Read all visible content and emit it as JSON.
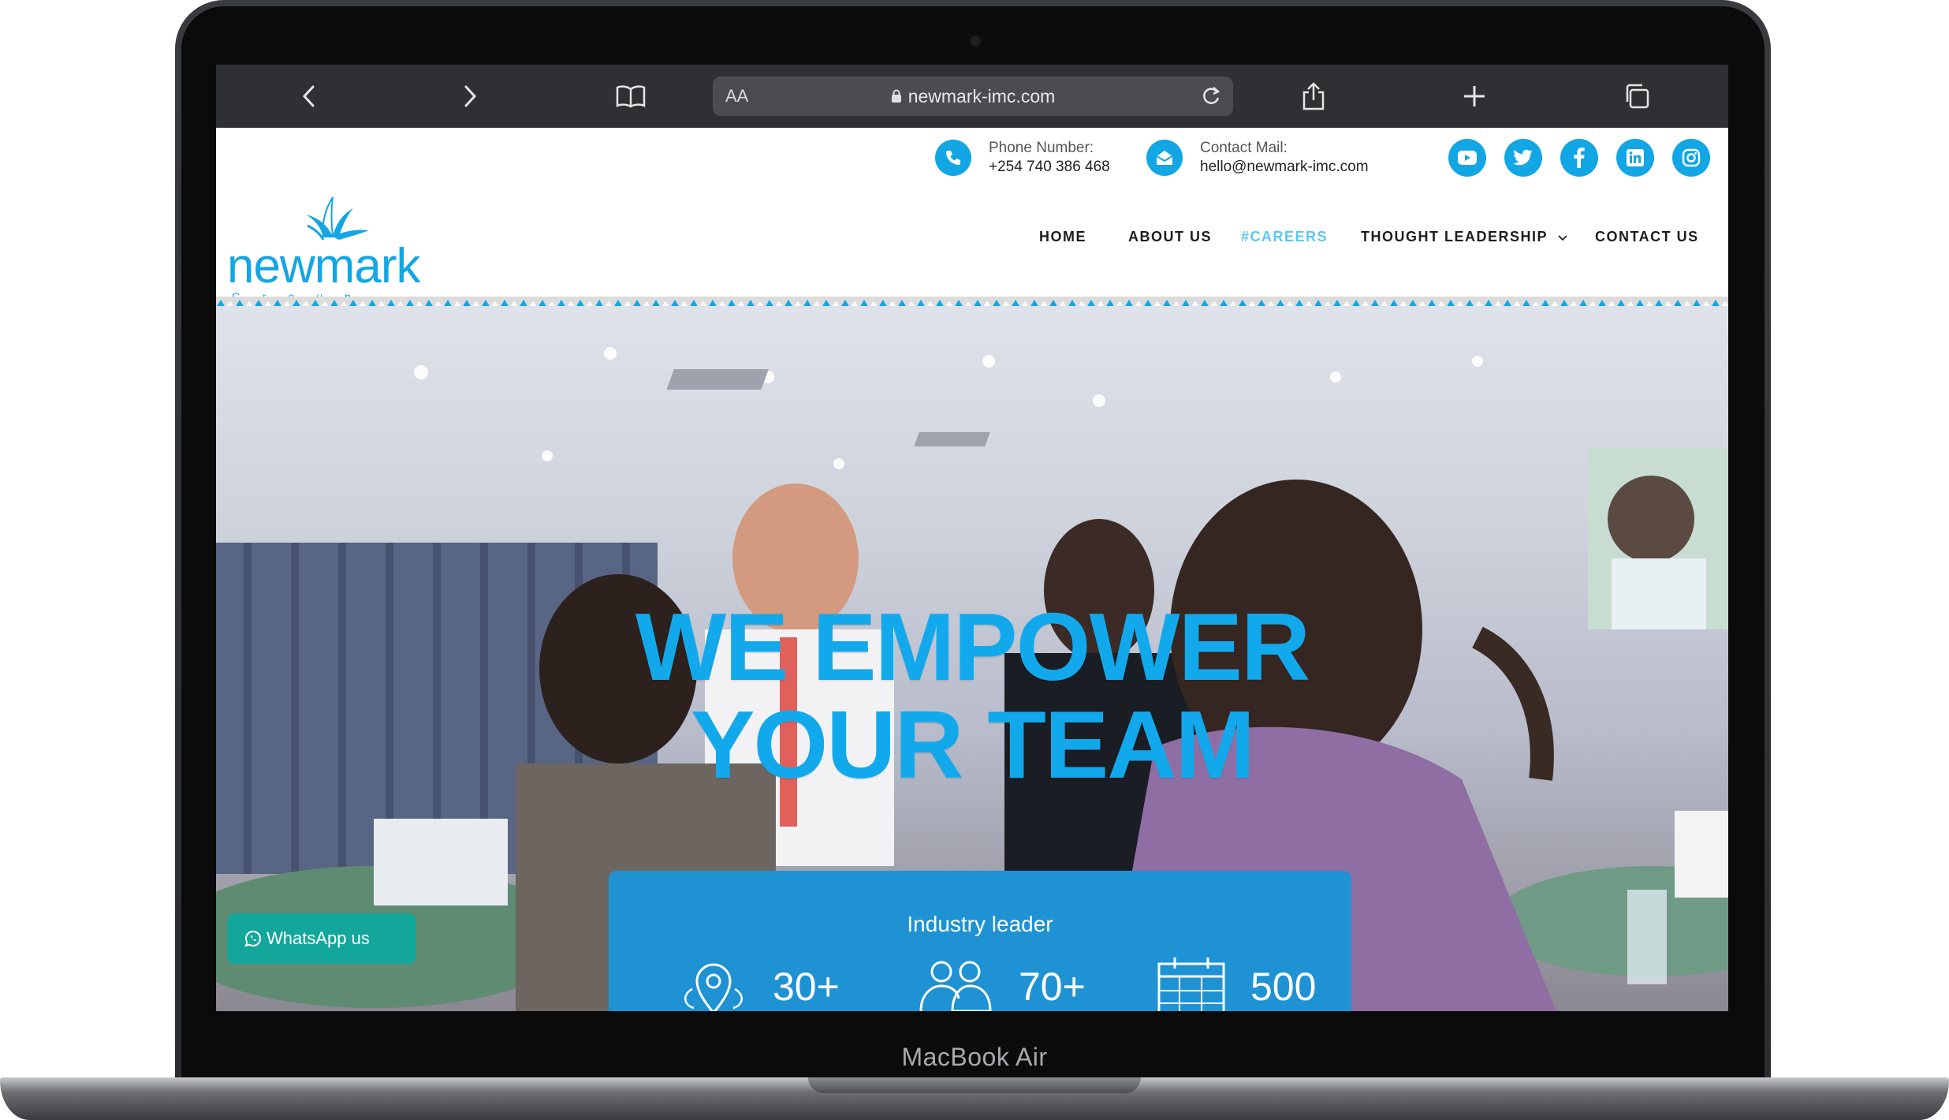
{
  "device": {
    "label": "MacBook Air"
  },
  "browser": {
    "url": "newmark-imc.com",
    "reader_label": "AA",
    "icons": [
      "back-icon",
      "forward-icon",
      "bookmarks-icon",
      "share-icon",
      "new-tab-icon",
      "tabs-icon",
      "lock-icon",
      "reload-icon"
    ]
  },
  "topbar": {
    "phone_label": "Phone Number:",
    "phone_value": "+254 740 386 468",
    "mail_label": "Contact Mail:",
    "mail_value": "hello@newmark-imc.com",
    "socials": [
      "youtube-icon",
      "twitter-icon",
      "facebook-icon",
      "linkedin-icon",
      "instagram-icon"
    ]
  },
  "logo": {
    "word": "newmark",
    "sub": "Group Ltd"
  },
  "nav": {
    "home": "HOME",
    "about": "ABOUT US",
    "careers": "#CAREERS",
    "thought": "THOUGHT LEADERSHIP",
    "contact": "CONTACT US",
    "active": "#CAREERS"
  },
  "hero": {
    "line1": "WE EMPOWER",
    "line2": "YOUR TEAM"
  },
  "stats": {
    "title": "Industry leader",
    "items": [
      {
        "icon": "location-icon",
        "value": "30+"
      },
      {
        "icon": "people-icon",
        "value": "70+"
      },
      {
        "icon": "calendar-icon",
        "value": "500"
      }
    ]
  },
  "whatsapp": {
    "label": "WhatsApp us"
  },
  "colors": {
    "brand": "#12a6e4",
    "stats_bg": "#1e92d3",
    "whatsapp": "#13a79b",
    "toolbar": "#2e3033"
  }
}
